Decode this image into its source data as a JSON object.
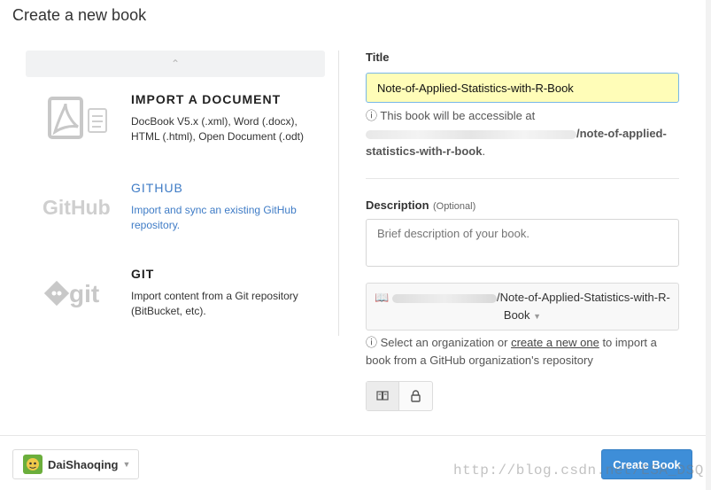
{
  "header": {
    "title": "Create a new book"
  },
  "sources": [
    {
      "name": "IMPORT A DOCUMENT",
      "desc": "DocBook V5.x (.xml), Word (.docx), HTML (.html), Open Document (.odt)",
      "icon": "pdf-document-icon"
    },
    {
      "name": "GITHUB",
      "desc": "Import and sync an existing GitHub repository.",
      "icon": "github-logo"
    },
    {
      "name": "GIT",
      "desc": "Import content from a Git repository (BitBucket, etc).",
      "icon": "git-logo"
    }
  ],
  "collapse_icon": "chevron-up-icon",
  "form": {
    "title_label": "Title",
    "title_value": "Note-of-Applied-Statistics-with-R-Book",
    "access_note": "This book will be accessible at",
    "access_url": "/note-of-applied-statistics-with-r-book",
    "description_label": "Description",
    "description_optional": "(Optional)",
    "description_placeholder": "Brief description of your book.",
    "repo_name": "/Note-of-Applied-Statistics-with-R-Book",
    "org_note_before": "Select an organization or",
    "org_note_link": "create a new one",
    "org_note_after": "to import a book from a GitHub organization's repository"
  },
  "footer": {
    "user_name": "DaiShaoqing",
    "create_label": "Create Book"
  },
  "watermark": "http://blog.csdn.net/ESA_DSQ",
  "colors": {
    "accent": "#3e8ed8",
    "github_link": "#3f7cc6",
    "title_input_bg": "#fffdb8"
  }
}
